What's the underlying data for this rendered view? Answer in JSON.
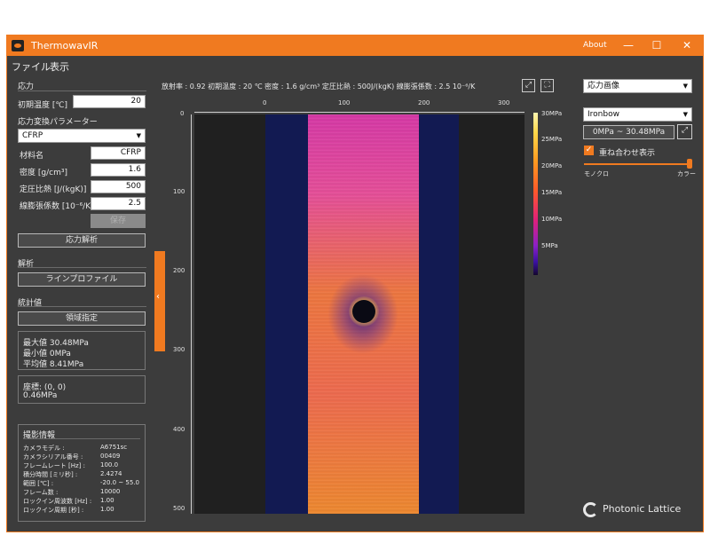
{
  "window": {
    "title": "ThermowavIR",
    "about": "About",
    "min": "—",
    "max": "☐",
    "close": "✕"
  },
  "menu": {
    "file": "ファイル",
    "view": "表示"
  },
  "left": {
    "stress_section": "応力",
    "init_temp_label": "初期温度 [℃]",
    "init_temp_value": "20",
    "conv_params_label": "応力変換パラメーター",
    "material_select": "CFRP",
    "material_name_label": "材料名",
    "material_name_value": "CFRP",
    "density_label": "密度 [g/cm³]",
    "density_value": "1.6",
    "heat_label": "定圧比熱 [J/(kgK)]",
    "heat_value": "500",
    "expansion_label": "線膨張係数 [10⁻⁶/K]",
    "expansion_value": "2.5",
    "save_button": "保存",
    "analyze_button": "応力解析",
    "analysis_section": "解析",
    "line_profile_button": "ラインプロファイル",
    "stats_section": "統計値",
    "region_button": "領域指定",
    "stats": [
      "最大値  30.48MPa",
      "最小値  0MPa",
      "平均値  8.41MPa"
    ],
    "coord_label": "座標:  (0, 0)",
    "coord_value": "0.46MPa",
    "info_section": "撮影情報",
    "info": [
      {
        "k": "カメラモデル :",
        "v": "A6751sc"
      },
      {
        "k": "カメラシリアル番号 :",
        "v": "00409"
      },
      {
        "k": "フレームレート [Hz] :",
        "v": "100.0"
      },
      {
        "k": "積分時間 [ミリ秒] :",
        "v": "2.4274"
      },
      {
        "k": "範囲 [℃] :",
        "v": "-20.0 ~ 55.0"
      },
      {
        "k": "フレーム数 :",
        "v": "10000"
      },
      {
        "k": "ロックイン周波数 [Hz] :",
        "v": "1.00"
      },
      {
        "k": "ロックイン周期 [秒] :",
        "v": "1.00"
      }
    ]
  },
  "header": {
    "text": "放射率 : 0.92   初期温度 : 20 ℃   密度 : 1.6 g/cm³   定圧比熱 : 500J/(kgK)   線膨張係数 : 2.5 10⁻⁶/K"
  },
  "plot": {
    "x_ticks": [
      "0",
      "100",
      "200",
      "300"
    ],
    "y_ticks": [
      "0",
      "100",
      "200",
      "300",
      "400",
      "500"
    ]
  },
  "colorbar": {
    "labels": [
      "30MPa",
      "25MPa",
      "20MPa",
      "15MPa",
      "10MPa",
      "5MPa"
    ]
  },
  "right": {
    "view_select": "応力画像",
    "palette_select": "Ironbow",
    "range_value": "0MPa ~ 30.48MPa",
    "overlay_label": "重ね合わせ表示",
    "overlay_checked": true,
    "mono_label": "モノクロ",
    "color_label": "カラー"
  },
  "brand": {
    "name": "Photonic Lattice"
  }
}
